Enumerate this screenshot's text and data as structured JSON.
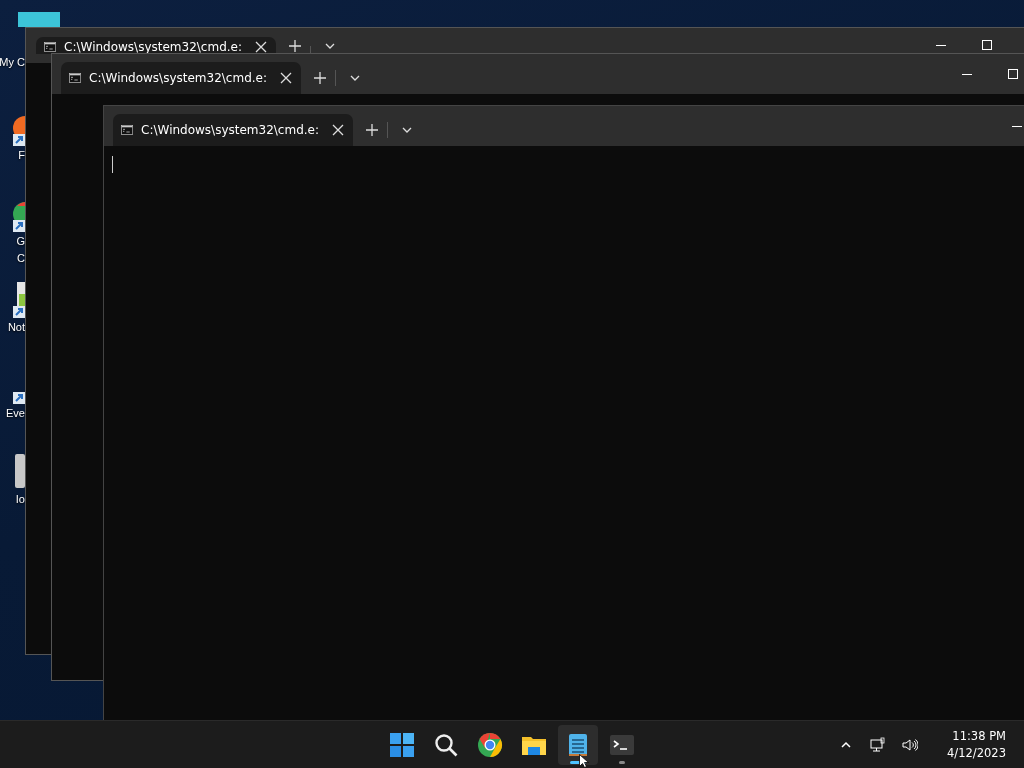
{
  "desktop": {
    "icons": [
      {
        "kind": "computer",
        "lines": [
          "My C"
        ]
      },
      {
        "kind": "firefox",
        "lines": [
          "F"
        ]
      },
      {
        "kind": "chrome",
        "lines": [
          "G",
          "C"
        ]
      },
      {
        "kind": "notepad",
        "lines": [
          "Not"
        ]
      },
      {
        "kind": "shortcut",
        "lines": [
          "Eve"
        ]
      },
      {
        "kind": "blank",
        "lines": [
          "Io"
        ]
      }
    ]
  },
  "windows": [
    {
      "tab": {
        "title": "C:\\Windows\\system32\\cmd.e:",
        "selected": true
      },
      "controls": [
        {
          "kind": "minimize"
        },
        {
          "kind": "maximize"
        }
      ],
      "caret": false
    },
    {
      "tab": {
        "title": "C:\\Windows\\system32\\cmd.e:",
        "selected": true
      },
      "controls": [
        {
          "kind": "minimize"
        },
        {
          "kind": "maximize"
        }
      ],
      "caret": false
    },
    {
      "tab": {
        "title": "C:\\Windows\\system32\\cmd.e:",
        "selected": true
      },
      "controls": [
        {
          "kind": "minimize"
        }
      ],
      "caret": true
    }
  ],
  "taskbar": {
    "apps": [
      {
        "kind": "start",
        "active": false,
        "running": false
      },
      {
        "kind": "search",
        "active": false,
        "running": false
      },
      {
        "kind": "chrome",
        "active": false,
        "running": false
      },
      {
        "kind": "explorer",
        "active": false,
        "running": false
      },
      {
        "kind": "notepad",
        "active": true,
        "running": true
      },
      {
        "kind": "terminal",
        "active": false,
        "running": true
      }
    ],
    "clock": {
      "time": "11:38 PM",
      "date": "4/12/2023"
    }
  }
}
